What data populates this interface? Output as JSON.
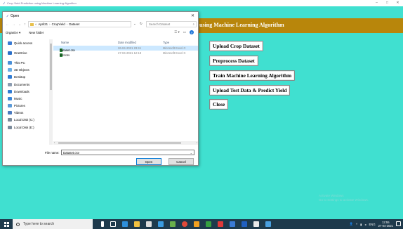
{
  "app_window": {
    "title": "Crop Yield Prediction using Machine Learning Algorithm",
    "header_title": "using Machine Learning Algorithm",
    "controls": [
      "–",
      "□",
      "✕"
    ],
    "colors": {
      "background": "#40e0d0",
      "header": "#b8860b"
    },
    "buttons": [
      {
        "label": "Upload Crop Dataset"
      },
      {
        "label": "Preprocess Dataset"
      },
      {
        "label": "Train Machine Learning Algorithm"
      },
      {
        "label": "Upload Test Data & Predict Yield"
      },
      {
        "label": "Close"
      }
    ],
    "watermark": {
      "line1": "Activate Windows",
      "line2": "Go to Settings to activate Windows."
    }
  },
  "dialog": {
    "title": "Open",
    "close": "✕",
    "address": {
      "crumbs": [
        "April21",
        "CropYield",
        "Dataset"
      ],
      "prefix": "«"
    },
    "search_placeholder": "Search Dataset",
    "toolbar": {
      "organize": "Organize ▾",
      "new_folder": "New folder",
      "help": "?"
    },
    "sidebar": [
      {
        "label": "Quick access",
        "icon": "star-icon",
        "color": "#3a7bd5"
      },
      {
        "label": "OneDrive",
        "icon": "cloud-icon",
        "color": "#2a6fc9"
      },
      {
        "label": "This PC",
        "icon": "pc-icon",
        "color": "#4a90d9"
      },
      {
        "label": "3D Objects",
        "icon": "cube-icon",
        "color": "#6aaee6"
      },
      {
        "label": "Desktop",
        "icon": "desktop-icon",
        "color": "#2f7bd4"
      },
      {
        "label": "Documents",
        "icon": "documents-icon",
        "color": "#8a9bb0"
      },
      {
        "label": "Downloads",
        "icon": "download-icon",
        "color": "#2f7bd4"
      },
      {
        "label": "Music",
        "icon": "music-icon",
        "color": "#3a86d8"
      },
      {
        "label": "Pictures",
        "icon": "pictures-icon",
        "color": "#5a9ad8"
      },
      {
        "label": "Videos",
        "icon": "videos-icon",
        "color": "#4a7ac0"
      },
      {
        "label": "Local Disk (C:)",
        "icon": "disk-icon",
        "color": "#7a8a9a"
      },
      {
        "label": "Local Disk (E:)",
        "icon": "disk-icon",
        "color": "#7a8a9a"
      }
    ],
    "columns": {
      "name": "Name",
      "date": "Date modified",
      "type": "Type"
    },
    "files": [
      {
        "name": "Dataset.csv",
        "date": "26-04-2021 23:41",
        "type": "Microsoft Excel C",
        "selected": true
      },
      {
        "name": "test.csv",
        "date": "27-04-2021 12:18",
        "type": "Microsoft Excel C",
        "selected": false
      }
    ],
    "file_name_label": "File name:",
    "file_name_value": "Dataset.csv",
    "open_label": "Open",
    "cancel_label": "Cancel"
  },
  "taskbar": {
    "search_placeholder": "Type here to search",
    "time": "12:55",
    "date": "27-04-2021",
    "icons": [
      {
        "name": "cortana-icon",
        "color": "#ffffff"
      },
      {
        "name": "task-view-icon",
        "color": "#ffffff"
      },
      {
        "name": "edge-icon",
        "color": "#2d8fdb"
      },
      {
        "name": "file-explorer-icon",
        "color": "#f0c040"
      },
      {
        "name": "store-icon",
        "color": "#ffffff"
      },
      {
        "name": "ie-icon",
        "color": "#3a9be0"
      },
      {
        "name": "app-icon-1",
        "color": "#6ab04c"
      },
      {
        "name": "chrome-icon",
        "color": "#e04a3a"
      },
      {
        "name": "app-icon-2",
        "color": "#f0a020"
      },
      {
        "name": "app-icon-3",
        "color": "#35a040"
      },
      {
        "name": "app-icon-4",
        "color": "#e03a3a"
      },
      {
        "name": "app-icon-5",
        "color": "#3a7bd5"
      },
      {
        "name": "app-icon-6",
        "color": "#2060c0"
      },
      {
        "name": "app-icon-7",
        "color": "#ffffff"
      },
      {
        "name": "python-icon",
        "color": "#4aa0e0"
      }
    ]
  }
}
